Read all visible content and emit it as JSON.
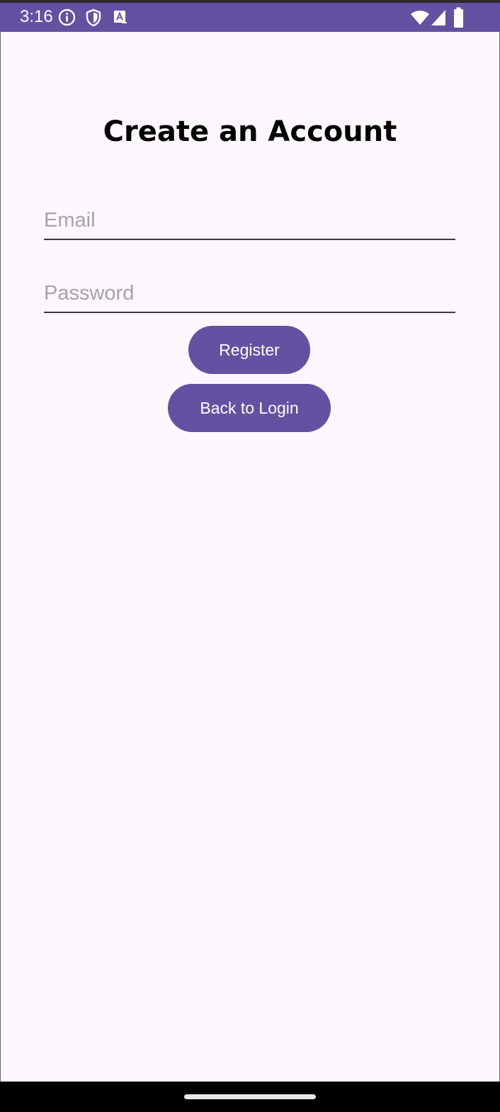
{
  "status_bar": {
    "time": "3:16",
    "left_icons": [
      "info-icon",
      "shield-icon",
      "text-a-icon"
    ],
    "right_icons": [
      "wifi-icon",
      "cell-signal-icon",
      "battery-icon"
    ],
    "background": "#6351a1"
  },
  "screen": {
    "title": "Create an Account",
    "email_field": {
      "placeholder": "Email",
      "value": ""
    },
    "password_field": {
      "placeholder": "Password",
      "value": ""
    },
    "register_button": {
      "label": "Register"
    },
    "back_button": {
      "label": "Back to Login"
    }
  },
  "colors": {
    "accent": "#6351a1",
    "background": "#fcf7fc",
    "placeholder": "#a6a2ac",
    "underline": "#3d3a44"
  }
}
